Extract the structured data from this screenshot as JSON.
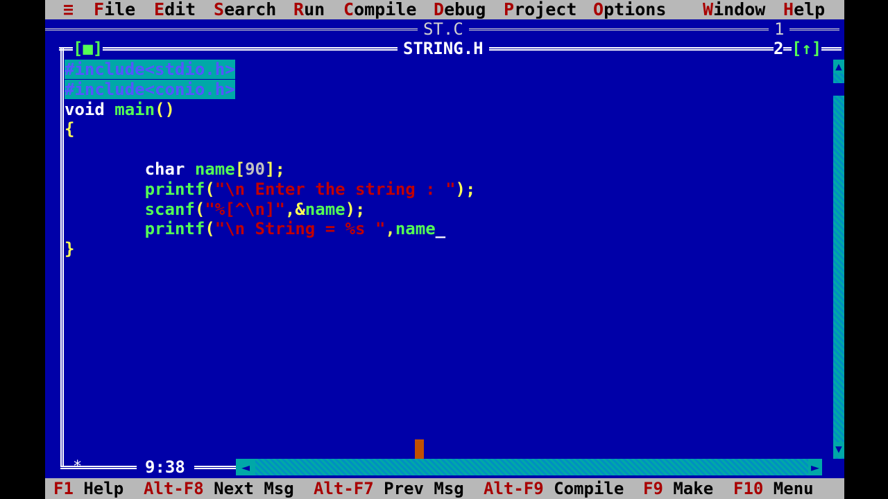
{
  "menu": {
    "system": "≡",
    "items": [
      {
        "hot": "F",
        "rest": "ile"
      },
      {
        "hot": "E",
        "rest": "dit"
      },
      {
        "hot": "S",
        "rest": "earch"
      },
      {
        "hot": "R",
        "rest": "un"
      },
      {
        "hot": "C",
        "rest": "ompile"
      },
      {
        "hot": "D",
        "rest": "ebug"
      },
      {
        "hot": "P",
        "rest": "roject"
      },
      {
        "hot": "O",
        "rest": "ptions"
      },
      {
        "hot": "W",
        "rest": "indow"
      },
      {
        "hot": "H",
        "rest": "elp"
      }
    ]
  },
  "back_window": {
    "title": "ST.C",
    "number": "1"
  },
  "editor": {
    "title": "STRING.H",
    "close_box": "[■]",
    "number": "2",
    "zoom_box": "[↑]",
    "position": "9:38",
    "modified_marker": "*"
  },
  "code": {
    "l1": "#include<stdio.h>",
    "l2": "#include<conio.h>",
    "l3a": "void",
    "l3b": " main",
    "l3c": "()",
    "l4": "{",
    "l6_indent": "        ",
    "l6a": "char",
    "l6b": " name",
    "l6c": "[",
    "l6d": "90",
    "l6e": "];",
    "l7a": "printf",
    "l7b": "(",
    "l7c": "\"\\n Enter the string : \"",
    "l7d": ");",
    "l8a": "scanf",
    "l8b": "(",
    "l8c": "\"%[^\\n]\"",
    "l8d": ",&",
    "l8e": "name",
    "l8f": ");",
    "l9a": "printf",
    "l9b": "(",
    "l9c": "\"\\n String = %s \"",
    "l9d": ",",
    "l9e": "name",
    "l9f": "_",
    "l10": "}"
  },
  "scroll": {
    "up": "▲",
    "down": "▼",
    "left": "◄",
    "right": "►"
  },
  "status": [
    {
      "key": "F1",
      "label": " Help"
    },
    {
      "key": "Alt-F8",
      "label": " Next Msg"
    },
    {
      "key": "Alt-F7",
      "label": " Prev Msg"
    },
    {
      "key": "Alt-F9",
      "label": " Compile"
    },
    {
      "key": "F9",
      "label": " Make"
    },
    {
      "key": "F10",
      "label": " Menu"
    }
  ],
  "colors": {
    "background": "#0000a8",
    "menu_bar": "#b8b8b8",
    "hotkey": "#a80000",
    "selection": "#00a8a8",
    "string": "#c00000",
    "identifier": "#55ff55"
  }
}
